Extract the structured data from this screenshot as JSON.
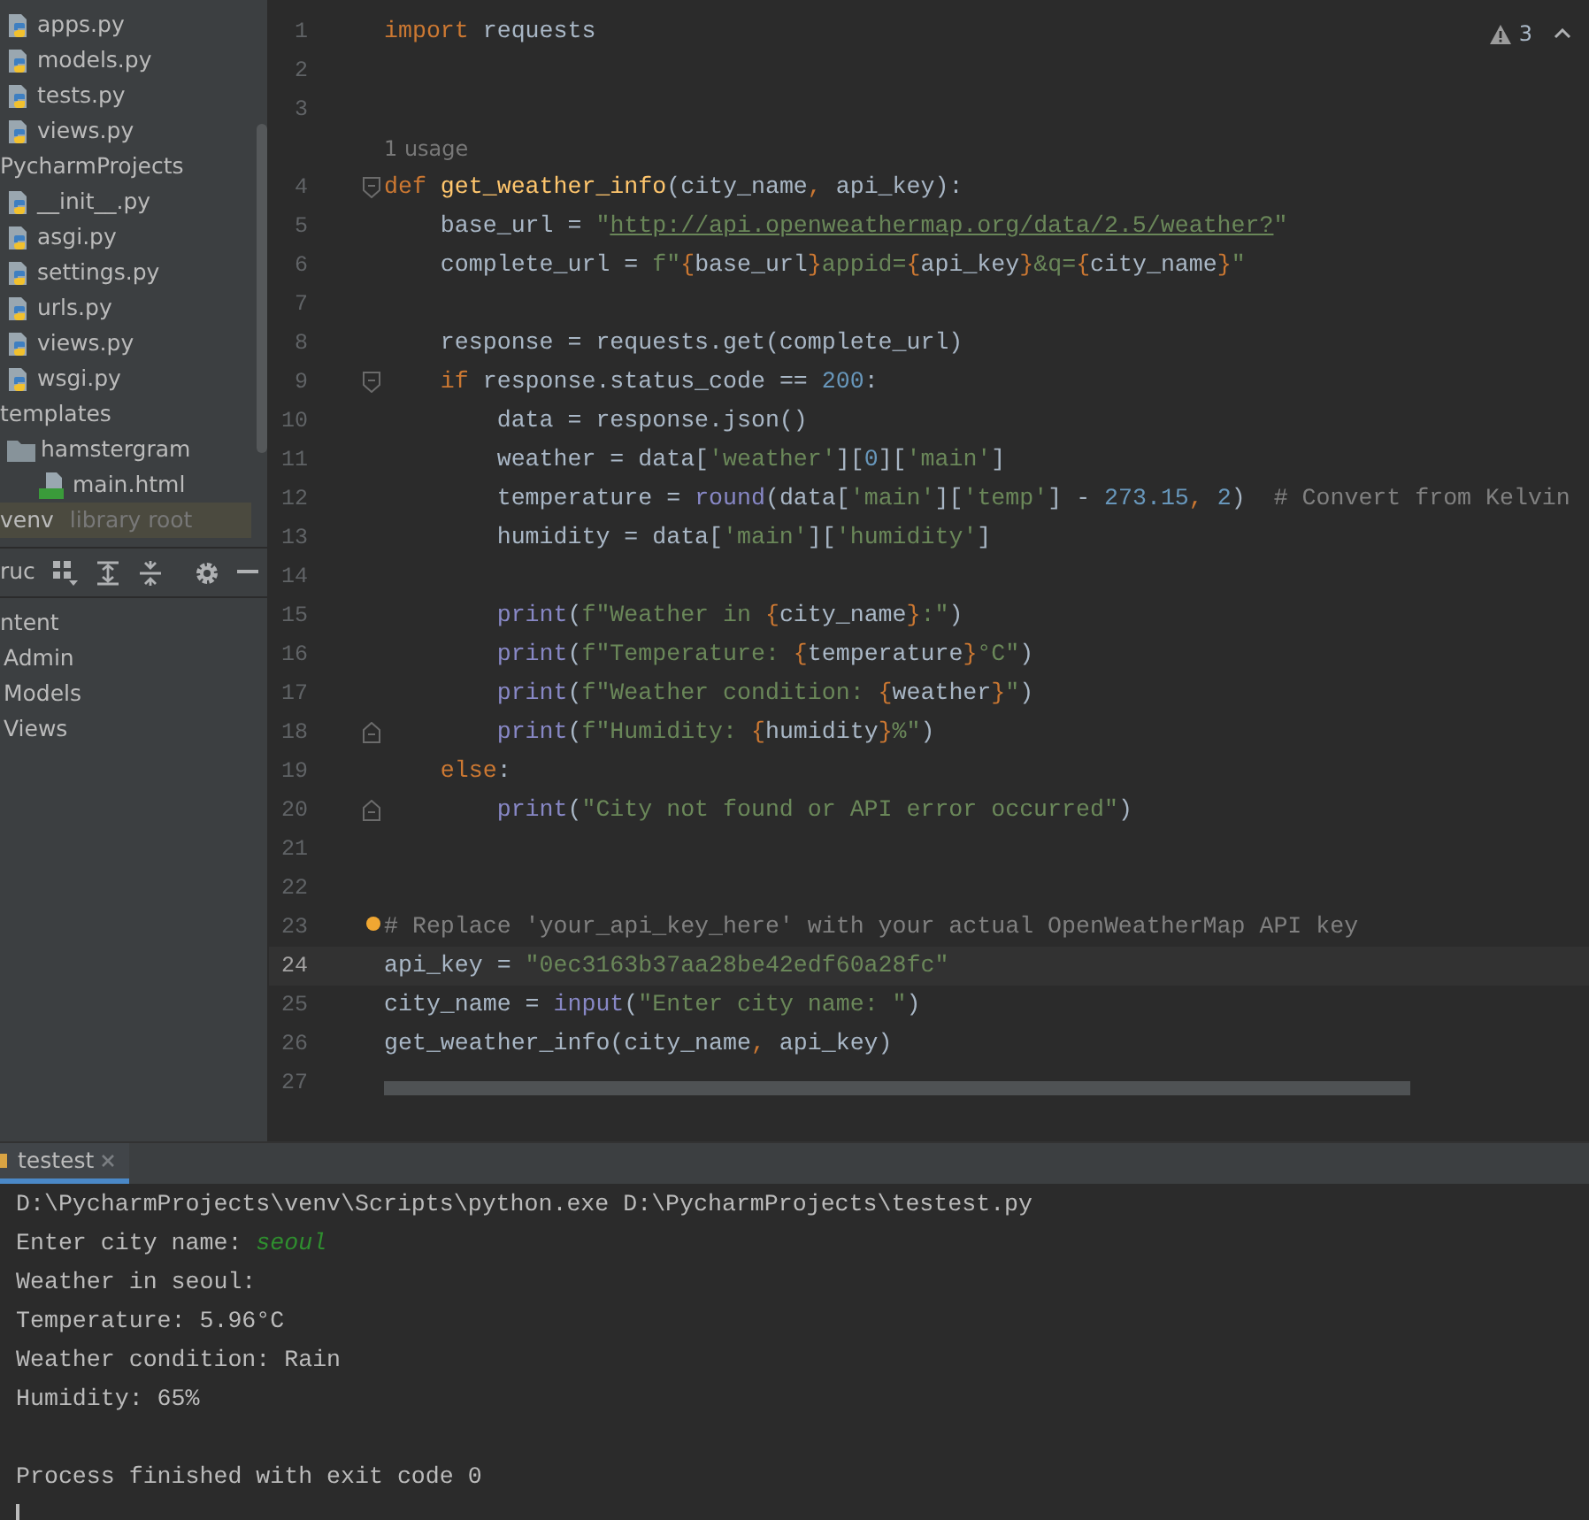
{
  "project_tree": [
    {
      "label": "apps.py",
      "kind": "python",
      "selected": false
    },
    {
      "label": "models.py",
      "kind": "python",
      "selected": false
    },
    {
      "label": "tests.py",
      "kind": "python",
      "selected": false
    },
    {
      "label": "views.py",
      "kind": "python",
      "selected": false
    },
    {
      "label": "PycharmProjects",
      "kind": "dir",
      "selected": false,
      "children": [
        {
          "label": "__init__.py",
          "kind": "python",
          "selected": false
        },
        {
          "label": "asgi.py",
          "kind": "python",
          "selected": false
        },
        {
          "label": "settings.py",
          "kind": "python",
          "selected": false
        },
        {
          "label": "urls.py",
          "kind": "python",
          "selected": false
        },
        {
          "label": "views.py",
          "kind": "python",
          "selected": false
        },
        {
          "label": "wsgi.py",
          "kind": "python",
          "selected": false
        }
      ]
    },
    {
      "label": "templates",
      "kind": "dir",
      "selected": false,
      "children": [
        {
          "label": "hamstergram",
          "kind": "folder",
          "selected": false,
          "children": [
            {
              "label": "main.html",
              "kind": "html",
              "selected": false
            }
          ]
        }
      ]
    },
    {
      "label": "venv",
      "hint": "library root",
      "kind": "dir",
      "selected": true
    }
  ],
  "structure": {
    "title": "ruc",
    "items": [
      {
        "label": "ntent",
        "selected": false
      },
      {
        "label": "Admin",
        "selected": false
      },
      {
        "label": "Models",
        "selected": false
      },
      {
        "label": "Views",
        "selected": false
      }
    ]
  },
  "editor": {
    "warnings": "3",
    "lines": [
      {
        "kind": "code",
        "number": "1",
        "current": false,
        "tokens": [
          {
            "kind": "kw",
            "text": "import"
          },
          {
            "kind": "p",
            "text": " requests"
          }
        ]
      },
      {
        "kind": "code",
        "number": "2",
        "current": false
      },
      {
        "kind": "code",
        "number": "3",
        "current": false
      },
      {
        "kind": "hint",
        "text": "1 usage"
      },
      {
        "kind": "code",
        "number": "4",
        "current": false,
        "fold_marker": {
          "kind": "start"
        },
        "tokens": [
          {
            "kind": "kw",
            "text": "def"
          },
          {
            "kind": "def",
            "text": " get_weather_info"
          },
          {
            "kind": "p",
            "text": "(city_name"
          },
          {
            "kind": "br",
            "text": ","
          },
          {
            "kind": "p",
            "text": " api_key):"
          }
        ]
      },
      {
        "kind": "code",
        "number": "5",
        "current": false,
        "tokens": [
          {
            "kind": "p",
            "text": "    base_url = "
          },
          {
            "kind": "str",
            "text": "\""
          },
          {
            "kind": "url",
            "text": "http://api.openweathermap.org/data/2.5/weather?"
          },
          {
            "kind": "str",
            "text": "\""
          }
        ]
      },
      {
        "kind": "code",
        "number": "6",
        "current": false,
        "tokens": [
          {
            "kind": "p",
            "text": "    complete_url = "
          },
          {
            "kind": "str",
            "text": "f\""
          },
          {
            "kind": "br",
            "text": "{"
          },
          {
            "kind": "p",
            "text": "base_url"
          },
          {
            "kind": "br",
            "text": "}"
          },
          {
            "kind": "str",
            "text": "appid="
          },
          {
            "kind": "br",
            "text": "{"
          },
          {
            "kind": "p",
            "text": "api_key"
          },
          {
            "kind": "br",
            "text": "}"
          },
          {
            "kind": "str",
            "text": "&q="
          },
          {
            "kind": "br",
            "text": "{"
          },
          {
            "kind": "p",
            "text": "city_name"
          },
          {
            "kind": "br",
            "text": "}"
          },
          {
            "kind": "str",
            "text": "\""
          }
        ]
      },
      {
        "kind": "code",
        "number": "7",
        "current": false
      },
      {
        "kind": "code",
        "number": "8",
        "current": false,
        "tokens": [
          {
            "kind": "p",
            "text": "    response = requests.get(complete_url)"
          }
        ]
      },
      {
        "kind": "code",
        "number": "9",
        "current": false,
        "fold_marker": {
          "kind": "start"
        },
        "tokens": [
          {
            "kind": "kw",
            "text": "    if"
          },
          {
            "kind": "p",
            "text": " response.status_code == "
          },
          {
            "kind": "num",
            "text": "200"
          },
          {
            "kind": "p",
            "text": ":"
          }
        ]
      },
      {
        "kind": "code",
        "number": "10",
        "current": false,
        "tokens": [
          {
            "kind": "p",
            "text": "        data = response.json()"
          }
        ]
      },
      {
        "kind": "code",
        "number": "11",
        "current": false,
        "tokens": [
          {
            "kind": "p",
            "text": "        weather = data["
          },
          {
            "kind": "str",
            "text": "'weather'"
          },
          {
            "kind": "p",
            "text": "]["
          },
          {
            "kind": "num",
            "text": "0"
          },
          {
            "kind": "p",
            "text": "]["
          },
          {
            "kind": "str",
            "text": "'main'"
          },
          {
            "kind": "p",
            "text": "]"
          }
        ]
      },
      {
        "kind": "code",
        "number": "12",
        "current": false,
        "tokens": [
          {
            "kind": "p",
            "text": "        temperature = "
          },
          {
            "kind": "bi",
            "text": "round"
          },
          {
            "kind": "p",
            "text": "(data["
          },
          {
            "kind": "str",
            "text": "'main'"
          },
          {
            "kind": "p",
            "text": "]["
          },
          {
            "kind": "str",
            "text": "'temp'"
          },
          {
            "kind": "p",
            "text": "] - "
          },
          {
            "kind": "num",
            "text": "273.15"
          },
          {
            "kind": "br",
            "text": ","
          },
          {
            "kind": "num",
            "text": " 2"
          },
          {
            "kind": "p",
            "text": ")"
          },
          {
            "kind": "cmt",
            "text": "  # Convert from Kelvin"
          }
        ]
      },
      {
        "kind": "code",
        "number": "13",
        "current": false,
        "tokens": [
          {
            "kind": "p",
            "text": "        humidity = data["
          },
          {
            "kind": "str",
            "text": "'main'"
          },
          {
            "kind": "p",
            "text": "]["
          },
          {
            "kind": "str",
            "text": "'humidity'"
          },
          {
            "kind": "p",
            "text": "]"
          }
        ]
      },
      {
        "kind": "code",
        "number": "14",
        "current": false
      },
      {
        "kind": "code",
        "number": "15",
        "current": false,
        "tokens": [
          {
            "kind": "bi",
            "text": "        print"
          },
          {
            "kind": "p",
            "text": "("
          },
          {
            "kind": "str",
            "text": "f\"Weather in "
          },
          {
            "kind": "br",
            "text": "{"
          },
          {
            "kind": "p",
            "text": "city_name"
          },
          {
            "kind": "br",
            "text": "}"
          },
          {
            "kind": "str",
            "text": ":\""
          },
          {
            "kind": "p",
            "text": ")"
          }
        ]
      },
      {
        "kind": "code",
        "number": "16",
        "current": false,
        "tokens": [
          {
            "kind": "bi",
            "text": "        print"
          },
          {
            "kind": "p",
            "text": "("
          },
          {
            "kind": "str",
            "text": "f\"Temperature: "
          },
          {
            "kind": "br",
            "text": "{"
          },
          {
            "kind": "p",
            "text": "temperature"
          },
          {
            "kind": "br",
            "text": "}"
          },
          {
            "kind": "str",
            "text": "°C\""
          },
          {
            "kind": "p",
            "text": ")"
          }
        ]
      },
      {
        "kind": "code",
        "number": "17",
        "current": false,
        "tokens": [
          {
            "kind": "bi",
            "text": "        print"
          },
          {
            "kind": "p",
            "text": "("
          },
          {
            "kind": "str",
            "text": "f\"Weather condition: "
          },
          {
            "kind": "br",
            "text": "{"
          },
          {
            "kind": "p",
            "text": "weather"
          },
          {
            "kind": "br",
            "text": "}"
          },
          {
            "kind": "str",
            "text": "\""
          },
          {
            "kind": "p",
            "text": ")"
          }
        ]
      },
      {
        "kind": "code",
        "number": "18",
        "current": false,
        "fold_marker": {
          "kind": "end"
        },
        "tokens": [
          {
            "kind": "bi",
            "text": "        print"
          },
          {
            "kind": "p",
            "text": "("
          },
          {
            "kind": "str",
            "text": "f\"Humidity: "
          },
          {
            "kind": "br",
            "text": "{"
          },
          {
            "kind": "p",
            "text": "humidity"
          },
          {
            "kind": "br",
            "text": "}"
          },
          {
            "kind": "str",
            "text": "%\""
          },
          {
            "kind": "p",
            "text": ")"
          }
        ]
      },
      {
        "kind": "code",
        "number": "19",
        "current": false,
        "tokens": [
          {
            "kind": "kw",
            "text": "    else"
          },
          {
            "kind": "p",
            "text": ":"
          }
        ]
      },
      {
        "kind": "code",
        "number": "20",
        "current": false,
        "fold_marker": {
          "kind": "end"
        },
        "tokens": [
          {
            "kind": "bi",
            "text": "        print"
          },
          {
            "kind": "p",
            "text": "("
          },
          {
            "kind": "str",
            "text": "\"City not found or API error occurred\""
          },
          {
            "kind": "p",
            "text": ")"
          }
        ]
      },
      {
        "kind": "code",
        "number": "21",
        "current": false
      },
      {
        "kind": "code",
        "number": "22",
        "current": false
      },
      {
        "kind": "code",
        "number": "23",
        "current": false,
        "bulb": true,
        "tokens": [
          {
            "kind": "cmt",
            "text": "# Replace 'your_api_key_here' with your actual OpenWeatherMap API key"
          }
        ]
      },
      {
        "kind": "code",
        "number": "24",
        "current": true,
        "tokens": [
          {
            "kind": "p",
            "text": "api_key = "
          },
          {
            "kind": "str",
            "text": "\"0ec3163b37aa28be42edf60a28fc\""
          }
        ]
      },
      {
        "kind": "code",
        "number": "25",
        "current": false,
        "tokens": [
          {
            "kind": "p",
            "text": "city_name = "
          },
          {
            "kind": "bi",
            "text": "input"
          },
          {
            "kind": "p",
            "text": "("
          },
          {
            "kind": "str",
            "text": "\"Enter city name: \""
          },
          {
            "kind": "p",
            "text": ")"
          }
        ]
      },
      {
        "kind": "code",
        "number": "26",
        "current": false,
        "tokens": [
          {
            "kind": "p",
            "text": "get_weather_info(city_name"
          },
          {
            "kind": "br",
            "text": ","
          },
          {
            "kind": "p",
            "text": " api_key)"
          }
        ]
      },
      {
        "kind": "code",
        "number": "27",
        "current": false
      }
    ]
  },
  "run_panel": {
    "tabs": [
      {
        "label": "testest",
        "selected": true
      }
    ],
    "console": [
      {
        "segments": [
          {
            "kind": "out",
            "text": "D:\\PycharmProjects\\venv\\Scripts\\python.exe D:\\PycharmProjects\\testest.py"
          }
        ]
      },
      {
        "segments": [
          {
            "kind": "out",
            "text": "Enter city name: "
          },
          {
            "kind": "input",
            "text": "seoul"
          }
        ]
      },
      {
        "segments": [
          {
            "kind": "out",
            "text": "Weather in seoul:"
          }
        ]
      },
      {
        "segments": [
          {
            "kind": "out",
            "text": "Temperature: 5.96°C"
          }
        ]
      },
      {
        "segments": [
          {
            "kind": "out",
            "text": "Weather condition: Rain"
          }
        ]
      },
      {
        "segments": [
          {
            "kind": "out",
            "text": "Humidity: 65%"
          }
        ]
      },
      {
        "kind": "blank"
      },
      {
        "segments": [
          {
            "kind": "out",
            "text": "Process finished with exit code 0"
          }
        ]
      }
    ]
  }
}
